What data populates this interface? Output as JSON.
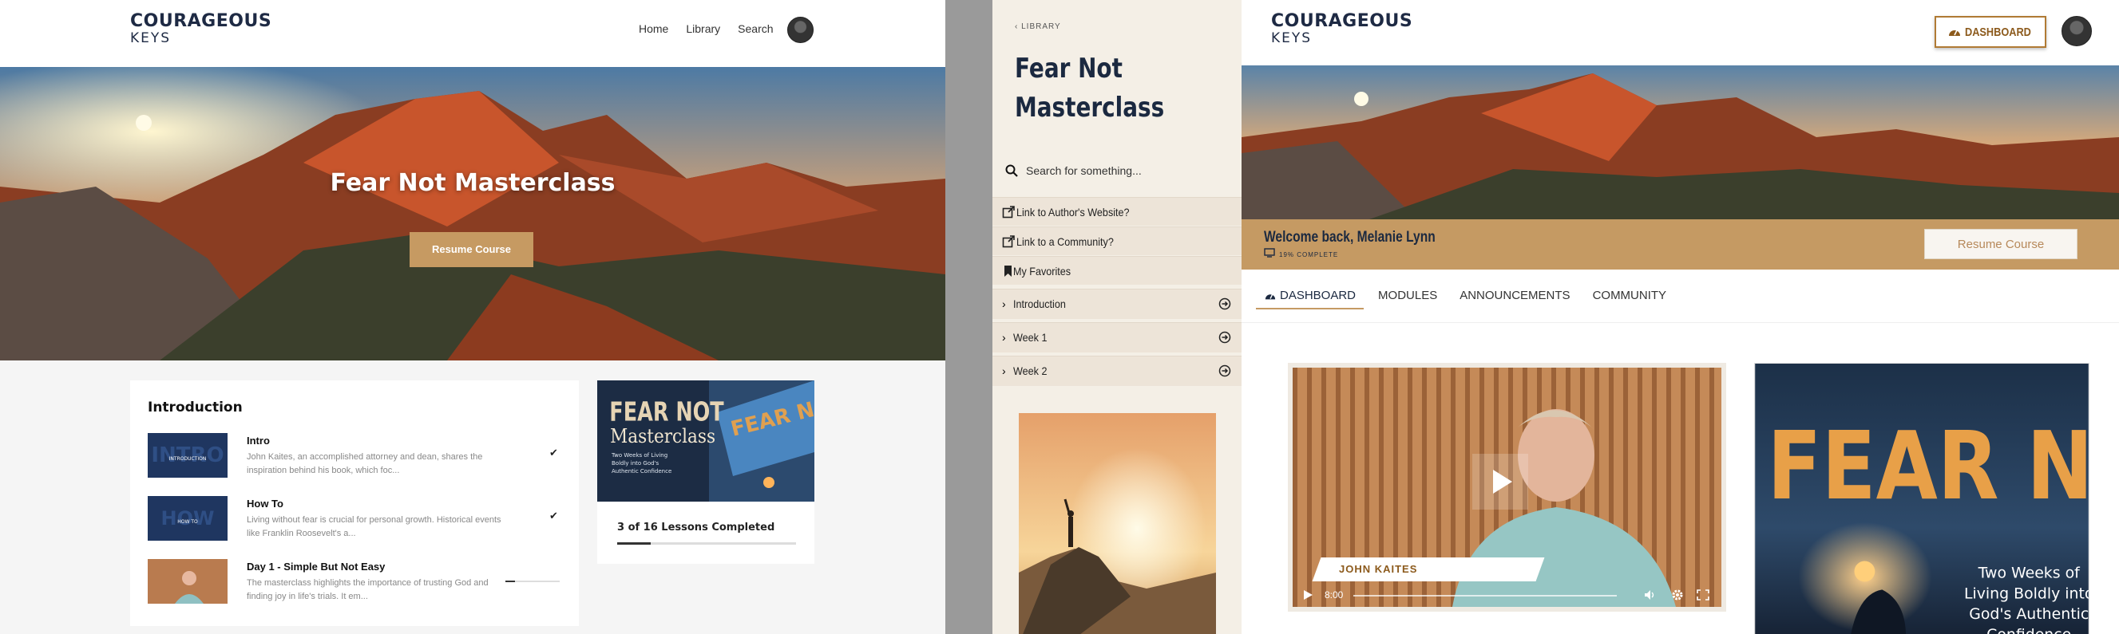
{
  "brand": {
    "line1": "COURAGEOUS",
    "line2": "KEYS"
  },
  "colors": {
    "accent": "#c69a62",
    "navy": "#1b2940",
    "sidebar_bg": "#f4efe6",
    "sidebar_row": "#ede4d8"
  },
  "screen1": {
    "nav": [
      "Home",
      "Library",
      "Search"
    ],
    "hero_title": "Fear Not Masterclass",
    "resume_label": "Resume Course",
    "section_title": "Introduction",
    "lessons": [
      {
        "title": "Intro",
        "desc": "John Kaites, an accomplished attorney and dean, shares the inspiration behind his book, which foc...",
        "thumb_text": "INTRODUCTION",
        "status": "complete"
      },
      {
        "title": "How To",
        "desc": "Living without fear is crucial for personal growth. Historical events like Franklin Roosevelt's a...",
        "thumb_text": "HOW TO",
        "status": "complete"
      },
      {
        "title": "Day 1 - Simple But Not Easy",
        "desc": "The masterclass highlights the importance of trusting God and finding joy in life's trials. It em...",
        "status": "in-progress"
      }
    ],
    "course_card": {
      "cover_title_1": "FEAR NOT",
      "cover_title_2": "Masterclass",
      "cover_subtitle": "Two Weeks of Living Boldly into God's Authentic Confidence",
      "progress_text": "3 of 16 Lessons Completed",
      "progress_fraction": 0.1875
    }
  },
  "screen2": {
    "back_label": "LIBRARY",
    "title": "Fear Not Masterclass",
    "search_placeholder": "Search for something...",
    "links": [
      {
        "label": "Link to Author's Website?",
        "icon": "external-link-icon"
      },
      {
        "label": "Link to a Community?",
        "icon": "external-link-icon"
      },
      {
        "label": "My Favorites",
        "icon": "bookmark-icon"
      }
    ],
    "modules": [
      "Introduction",
      "Week 1",
      "Week 2"
    ]
  },
  "screen3": {
    "dashboard_label": "DASHBOARD",
    "welcome": "Welcome back, Melanie Lynn",
    "complete_text": "19% COMPLETE",
    "resume_label": "Resume Course",
    "tabs": [
      "DASHBOARD",
      "MODULES",
      "ANNOUNCEMENTS",
      "COMMUNITY"
    ],
    "video": {
      "speaker": "JOHN KAITES",
      "time": "8:00"
    },
    "cover": {
      "title": "FEAR NOT",
      "subtitle": "Two Weeks of Living Boldly into God's Authentic Confidence"
    }
  }
}
